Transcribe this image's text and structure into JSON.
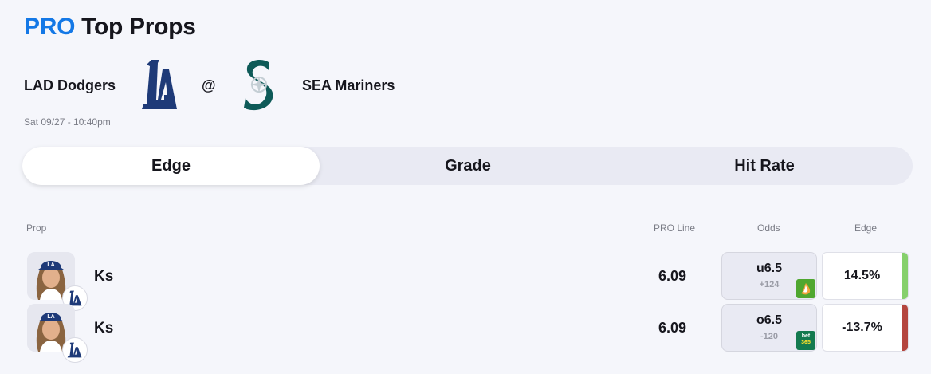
{
  "header": {
    "pro": "PRO",
    "title": "Top Props"
  },
  "game": {
    "away_team": "LAD Dodgers",
    "home_team": "SEA Mariners",
    "at": "@",
    "datetime": "Sat 09/27 - 10:40pm",
    "away_logo": "dodgers-la-logo",
    "home_logo": "mariners-s-logo",
    "away_color": "#1e3a78",
    "home_color": "#0e5a58"
  },
  "tabs": [
    {
      "label": "Edge",
      "active": true
    },
    {
      "label": "Grade",
      "active": false
    },
    {
      "label": "Hit Rate",
      "active": false
    }
  ],
  "columns": {
    "prop": "Prop",
    "pro_line": "PRO Line",
    "odds": "Odds",
    "edge": "Edge"
  },
  "rows": [
    {
      "prop": "Ks",
      "pro_line": "6.09",
      "odds_line": "u6.5",
      "odds_price": "+124",
      "book": "draftkings-icon",
      "edge": "14.5%",
      "edge_color": "#86d06c"
    },
    {
      "prop": "Ks",
      "pro_line": "6.09",
      "odds_line": "o6.5",
      "odds_price": "-120",
      "book": "bet365-icon",
      "book_text_1": "bet",
      "book_text_2": "365",
      "edge": "-13.7%",
      "edge_color": "#b4463f"
    }
  ],
  "colors": {
    "accent": "#1478e6",
    "positive": "#86d06c",
    "negative": "#b4463f"
  }
}
